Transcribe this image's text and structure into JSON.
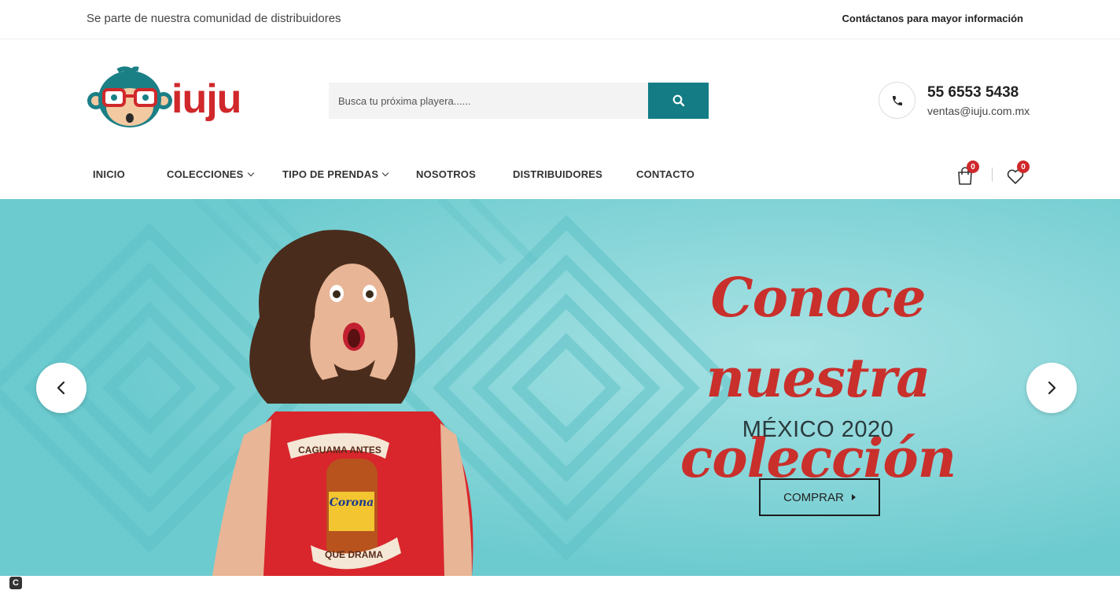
{
  "topbar": {
    "left_text": "Se parte de nuestra comunidad de distribuidores",
    "right_text": "Contáctanos para mayor información"
  },
  "header": {
    "logo_text": "iuju",
    "search": {
      "placeholder": "Busca tu próxima playera......",
      "button_icon": "search-icon"
    },
    "contact": {
      "phone": "55 6553 5438",
      "email": "ventas@iuju.com.mx",
      "icon": "phone-icon"
    }
  },
  "nav": {
    "items": [
      {
        "label": "INICIO",
        "has_dropdown": false
      },
      {
        "label": "COLECCIONES",
        "has_dropdown": true
      },
      {
        "label": "TIPO DE PRENDAS",
        "has_dropdown": true
      },
      {
        "label": "NOSOTROS",
        "has_dropdown": false
      },
      {
        "label": "DISTRIBUIDORES",
        "has_dropdown": false
      },
      {
        "label": "CONTACTO",
        "has_dropdown": false
      }
    ],
    "cart": {
      "icon": "shopping-bag-icon",
      "count": "0"
    },
    "wishlist": {
      "icon": "heart-icon",
      "count": "0"
    }
  },
  "hero": {
    "title_line1": "Conoce nuestra",
    "title_line2": "colección",
    "subtitle": "MÉXICO 2020",
    "button_label": "COMPRAR",
    "shirt_text_top": "CAGUAMA ANTES",
    "shirt_brand": "Corona",
    "shirt_text_bottom": "QUE DRAMA",
    "prev_icon": "chevron-left-icon",
    "next_icon": "chevron-right-icon"
  },
  "colors": {
    "brand_red": "#d0282b",
    "teal_button": "#137c84",
    "hero_bg": "#7ccfd3",
    "hero_title": "#c9302c"
  }
}
